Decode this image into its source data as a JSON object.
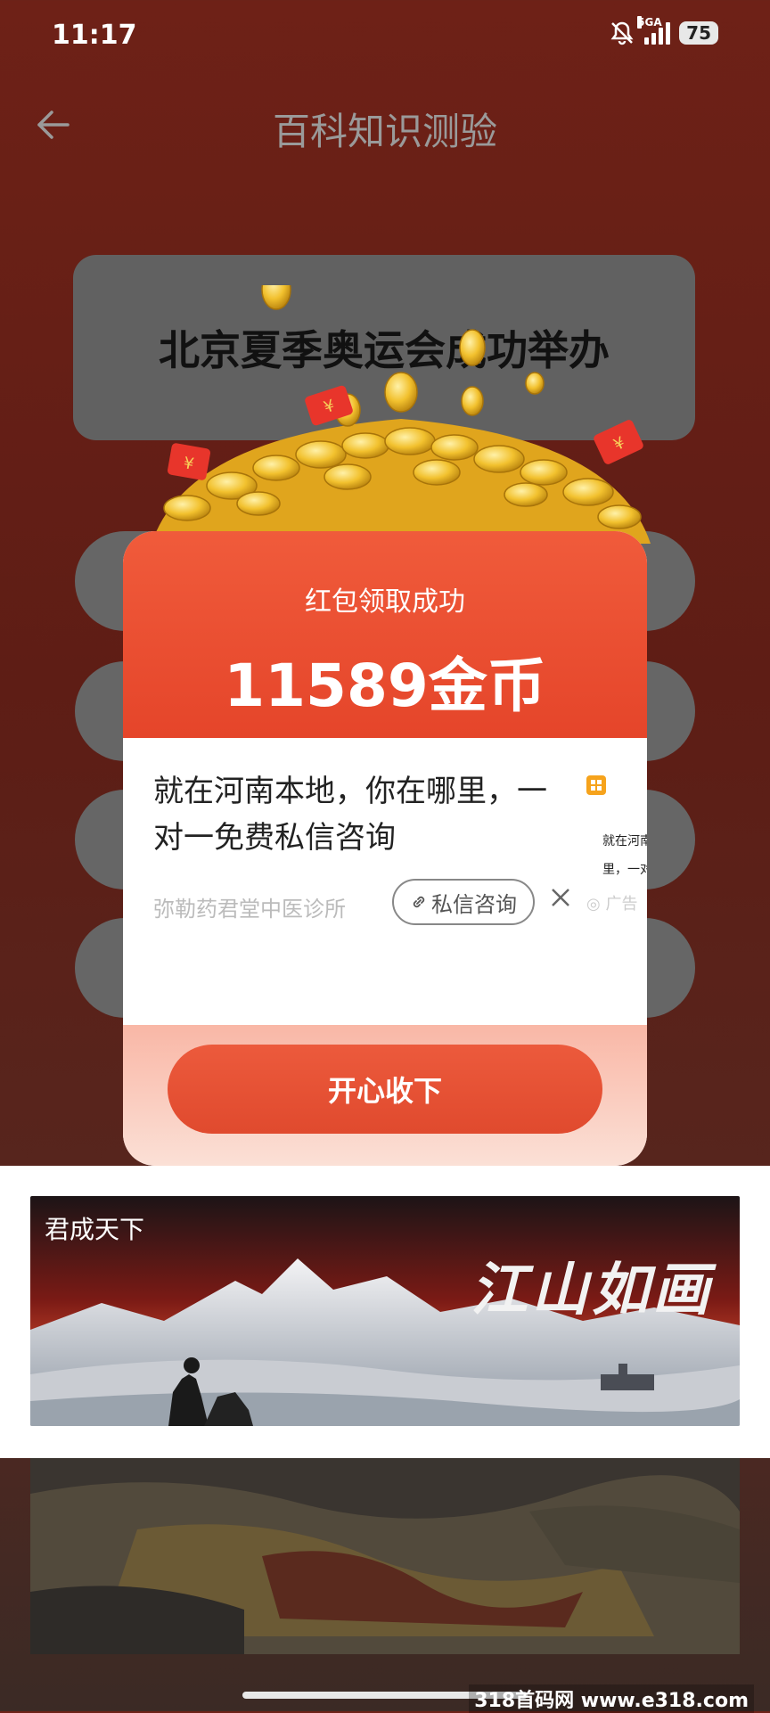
{
  "status_bar": {
    "time": "11:17",
    "network": "5GA",
    "battery": "75"
  },
  "header": {
    "title": "百科知识测验"
  },
  "quiz": {
    "question": "北京夏季奥运会成功举办"
  },
  "modal": {
    "title": "红包领取成功",
    "amount": "11589金币",
    "accept_label": "开心收下",
    "ad": {
      "text": "就在河南本地，你在哪里，一对一免费私信咨询",
      "advertiser": "弥勒药君堂中医诊所",
      "chat_label": "私信咨询",
      "side_text_line1": "就在河南",
      "side_text_line2": "里，一对",
      "ad_mark": "广告"
    }
  },
  "banner": {
    "label": "君成天下",
    "calligraphy": "江山如画"
  },
  "watermark": "318首码网 www.e318.com",
  "colors": {
    "accent_red": "#e5452a",
    "background": "#5e1d15",
    "coin_gold": "#f2c12e"
  }
}
